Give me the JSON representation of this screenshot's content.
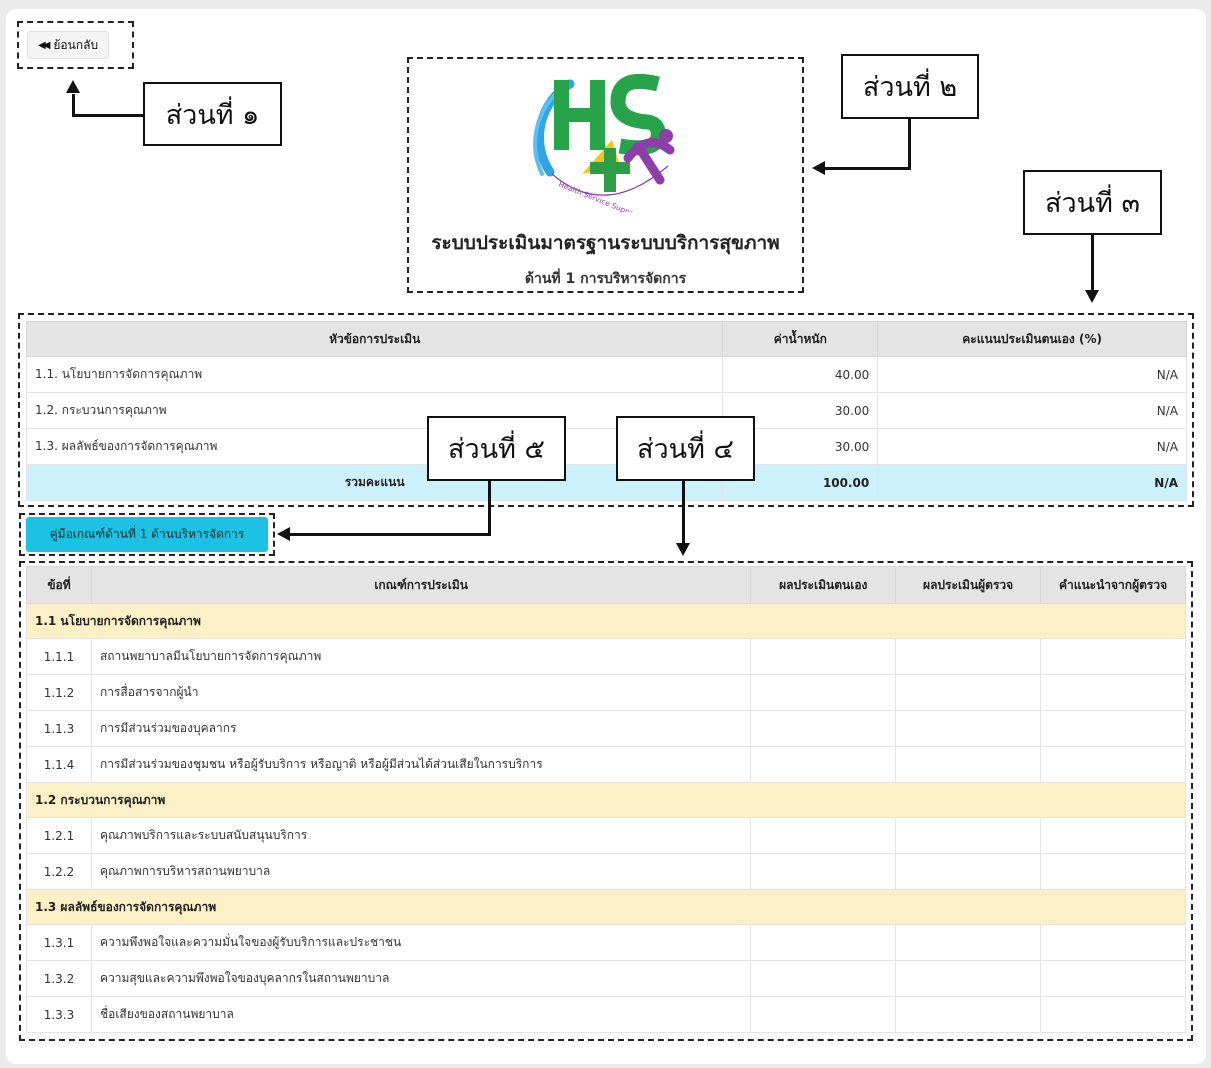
{
  "back_button": {
    "icon": "double-left-arrow-icon",
    "label": "ย้อนกลับ"
  },
  "header": {
    "logo_text": "HS4",
    "logo_ring_text": "Health Service Support Standard System",
    "title": "ระบบประเมินมาตรฐานระบบบริการสุขภาพ",
    "subtitle": "ด้านที่ 1 การบริหารจัดการ"
  },
  "callouts": {
    "part1": "ส่วนที่ ๑",
    "part2": "ส่วนที่ ๒",
    "part3": "ส่วนที่ ๓",
    "part4": "ส่วนที่ ๔",
    "part5": "ส่วนที่ ๕"
  },
  "summary_table": {
    "headers": [
      "หัวข้อการประเมิน",
      "ค่าน้ำหนัก",
      "คะแนนประเมินตนเอง (%)"
    ],
    "rows": [
      {
        "topic": "1.1. นโยบายการจัดการคุณภาพ",
        "weight": "40.00",
        "score": "N/A"
      },
      {
        "topic": "1.2. กระบวนการคุณภาพ",
        "weight": "30.00",
        "score": "N/A"
      },
      {
        "topic": "1.3. ผลลัพธ์ของการจัดการคุณภาพ",
        "weight": "30.00",
        "score": "N/A"
      }
    ],
    "total": {
      "label": "รวมคะแนน",
      "weight": "100.00",
      "score": "N/A"
    }
  },
  "manual_button": {
    "label": "คู่มือเกณฑ์ด้านที่ 1 ด้านบริหารจัดการ"
  },
  "criteria_table": {
    "headers": [
      "ข้อที่",
      "เกณฑ์การประเมิน",
      "ผลประเมินตนเอง",
      "ผลประเมินผู้ตรวจ",
      "คำแนะนำจากผู้ตรวจ"
    ],
    "groups": [
      {
        "title": "1.1 นโยบายการจัดการคุณภาพ",
        "items": [
          {
            "no": "1.1.1",
            "text": "สถานพยาบาลมีนโยบายการจัดการคุณภาพ"
          },
          {
            "no": "1.1.2",
            "text": "การสื่อสารจากผู้นำ"
          },
          {
            "no": "1.1.3",
            "text": "การมีส่วนร่วมของบุคลากร"
          },
          {
            "no": "1.1.4",
            "text": "การมีส่วนร่วมของชุมชน หรือผู้รับบริการ หรือญาติ หรือผู้มีส่วนได้ส่วนเสียในการบริการ"
          }
        ]
      },
      {
        "title": "1.2 กระบวนการคุณภาพ",
        "items": [
          {
            "no": "1.2.1",
            "text": "คุณภาพบริการและระบบสนับสนุนบริการ"
          },
          {
            "no": "1.2.2",
            "text": "คุณภาพการบริหารสถานพยาบาล"
          }
        ]
      },
      {
        "title": "1.3 ผลลัพธ์ของการจัดการคุณภาพ",
        "items": [
          {
            "no": "1.3.1",
            "text": "ความพึงพอใจและความมั่นใจของผู้รับบริการและประชาชน"
          },
          {
            "no": "1.3.2",
            "text": "ความสุขและความพึงพอใจของบุคลากรในสถานพยาบาล"
          },
          {
            "no": "1.3.3",
            "text": "ชื่อเสียงของสถานพยาบาล"
          }
        ]
      }
    ]
  },
  "colors": {
    "accent": "#1cc2e3",
    "total_row": "#cdf1fb",
    "group_row": "#fcf0c6",
    "header_row": "#e4e4e4"
  }
}
